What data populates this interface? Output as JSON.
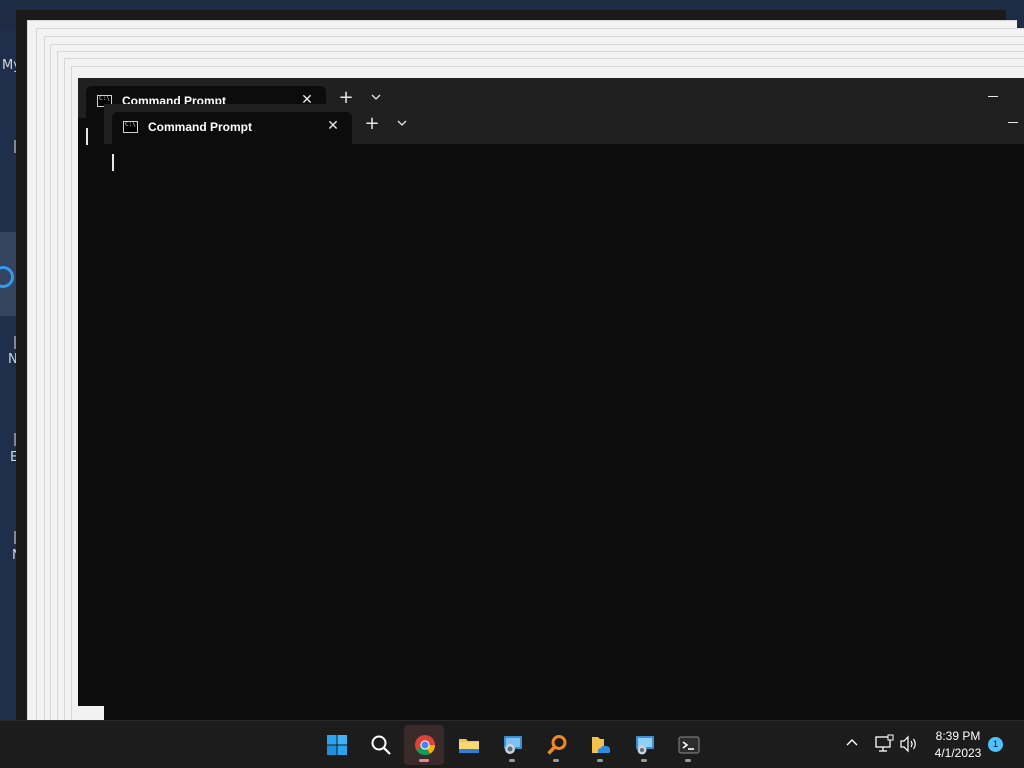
{
  "desktop": {
    "left_labels": [
      "My",
      "N",
      "E",
      "N"
    ]
  },
  "terminal_back": {
    "tab_title": "Command Prompt"
  },
  "terminal_front": {
    "tab_title": "Command Prompt",
    "close_glyph": "✕",
    "new_tab_glyph": "+"
  },
  "taskbar": {
    "apps": [
      {
        "name": "Start",
        "icon": "windows-start-icon"
      },
      {
        "name": "Search",
        "icon": "search-icon"
      },
      {
        "name": "Google Chrome",
        "icon": "chrome-icon",
        "active": true
      },
      {
        "name": "File Explorer",
        "icon": "folder-icon"
      },
      {
        "name": "Remote Desktop",
        "icon": "remote-desktop-icon"
      },
      {
        "name": "Search Tool",
        "icon": "magnifier-app-icon"
      },
      {
        "name": "OneDrive Folder",
        "icon": "cloud-folder-icon"
      },
      {
        "name": "Remote Desktop Connection",
        "icon": "remote-connection-icon"
      },
      {
        "name": "Terminal",
        "icon": "terminal-icon"
      }
    ],
    "clock_time": "8:39 PM",
    "clock_date": "4/1/2023",
    "notification_count": "1"
  },
  "colors": {
    "terminal_bg": "#0c0c0c",
    "titlebar_bg": "#202020",
    "taskbar_bg": "#1c1c1c",
    "accent": "#4cc2ff"
  }
}
